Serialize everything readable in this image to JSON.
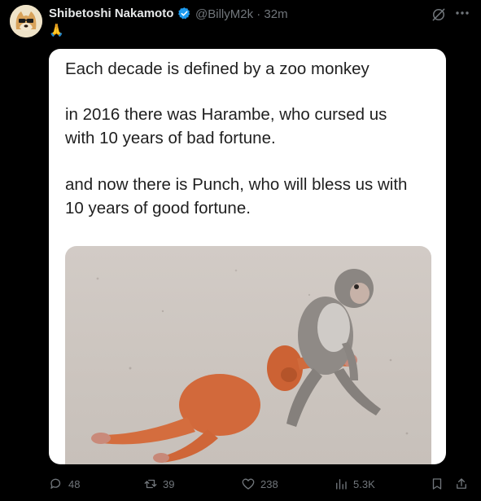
{
  "post": {
    "author_name": "Shibetoshi Nakamoto",
    "handle_time": "@BillyM2k · 32m",
    "emoji": "🙏"
  },
  "media": {
    "line1": "Each decade is defined by a zoo monkey",
    "para2": "in 2016 there was Harambe, who cursed us\nwith 10 years of bad fortune.",
    "para3": "and now there is Punch, who will bless us with\n10 years of good fortune."
  },
  "actions": {
    "replies": "48",
    "reposts": "39",
    "likes": "238",
    "views": "5.3K"
  },
  "colors": {
    "accent_blue": "#1d9bf0",
    "muted": "#71767b",
    "text": "#e7e9ea"
  }
}
